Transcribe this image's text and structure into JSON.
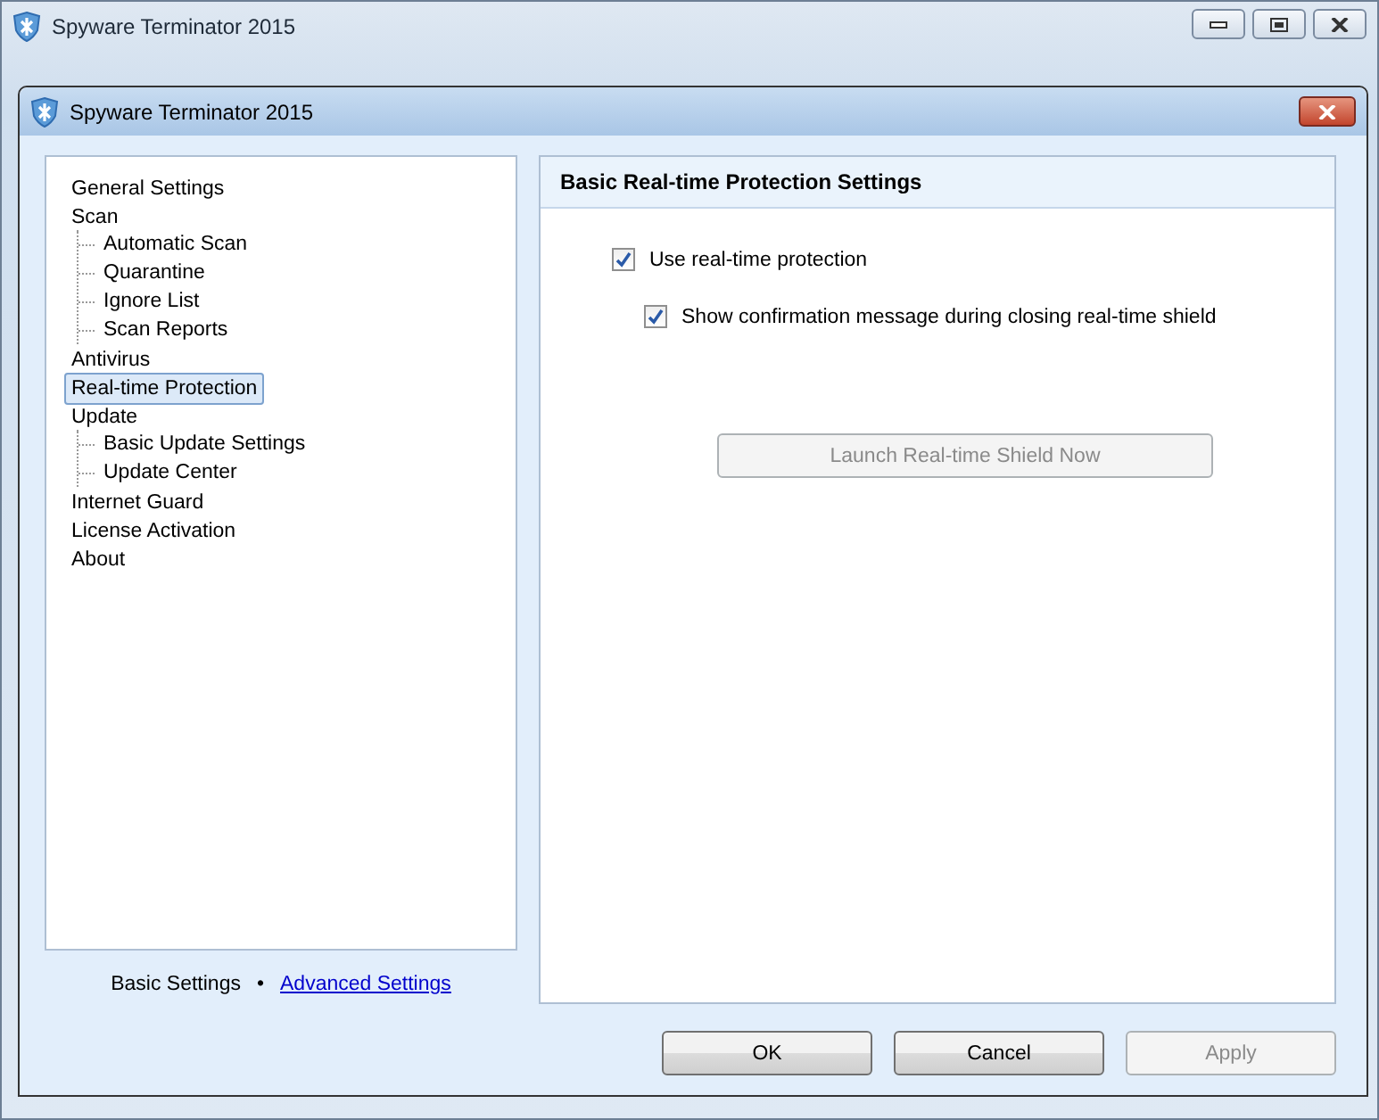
{
  "window": {
    "title": "Spyware Terminator 2015"
  },
  "dialog": {
    "title": "Spyware Terminator 2015"
  },
  "sidebar": {
    "items": [
      {
        "label": "General Settings",
        "selected": false
      },
      {
        "label": "Scan",
        "selected": false,
        "children": [
          {
            "label": "Automatic Scan",
            "selected": false
          },
          {
            "label": "Quarantine",
            "selected": false
          },
          {
            "label": "Ignore List",
            "selected": false
          },
          {
            "label": "Scan Reports",
            "selected": false
          }
        ]
      },
      {
        "label": "Antivirus",
        "selected": false
      },
      {
        "label": "Real-time Protection",
        "selected": true
      },
      {
        "label": "Update",
        "selected": false,
        "children": [
          {
            "label": "Basic Update Settings",
            "selected": false
          },
          {
            "label": "Update Center",
            "selected": false
          }
        ]
      },
      {
        "label": "Internet Guard",
        "selected": false
      },
      {
        "label": "License Activation",
        "selected": false
      },
      {
        "label": "About",
        "selected": false
      }
    ],
    "footer": {
      "current": "Basic Settings",
      "separator": "•",
      "link": "Advanced Settings"
    }
  },
  "panel": {
    "title": "Basic Real-time Protection Settings",
    "options": [
      {
        "label": "Use real-time protection",
        "checked": true,
        "children": [
          {
            "label": "Show confirmation message during closing real-time shield",
            "checked": true
          }
        ]
      }
    ],
    "action": {
      "label": "Launch Real-time Shield Now",
      "disabled": true
    }
  },
  "buttons": [
    {
      "label": "OK",
      "disabled": false
    },
    {
      "label": "Cancel",
      "disabled": false
    },
    {
      "label": "Apply",
      "disabled": true
    }
  ]
}
